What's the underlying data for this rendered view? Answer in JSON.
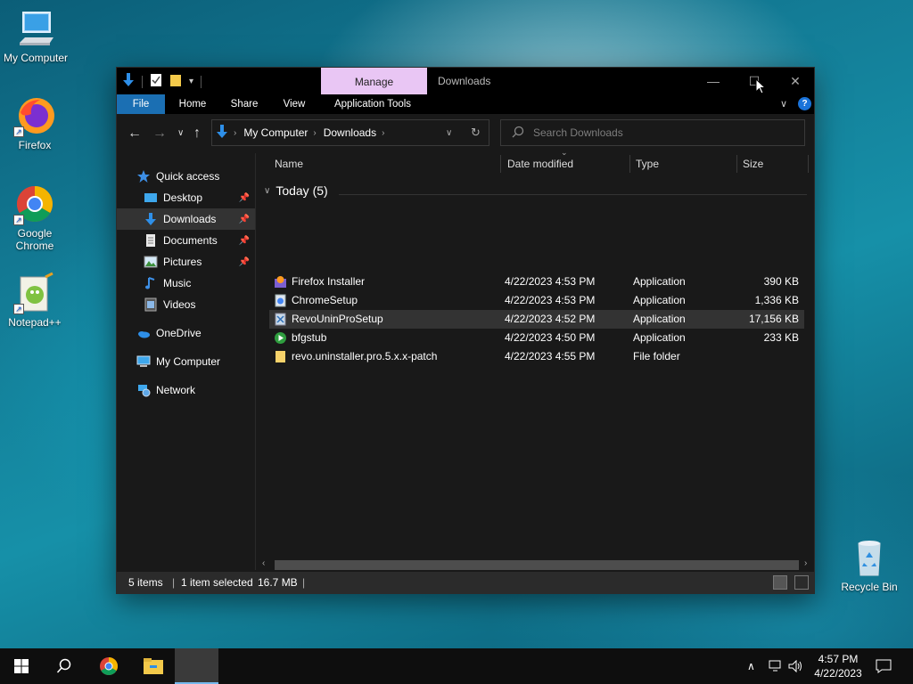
{
  "desktop": {
    "icons": [
      {
        "label": "My Computer"
      },
      {
        "label": "Firefox"
      },
      {
        "label": "Google Chrome"
      },
      {
        "label": "Notepad++"
      },
      {
        "label": "Recycle Bin"
      }
    ]
  },
  "window": {
    "contextual_tab": "Manage",
    "title": "Downloads",
    "ribbon_tabs": [
      "File",
      "Home",
      "Share",
      "View",
      "Application Tools"
    ],
    "address": {
      "crumbs": [
        "My Computer",
        "Downloads"
      ]
    },
    "search": {
      "placeholder": "Search Downloads"
    },
    "nav_pane": {
      "quick_access": "Quick access",
      "quick_items": [
        "Desktop",
        "Downloads",
        "Documents",
        "Pictures",
        "Music",
        "Videos"
      ],
      "onedrive": "OneDrive",
      "my_computer": "My Computer",
      "network": "Network"
    },
    "columns": {
      "name": "Name",
      "date": "Date modified",
      "type": "Type",
      "size": "Size"
    },
    "group": "Today (5)",
    "files": [
      {
        "name": "Firefox Installer",
        "date": "4/22/2023 4:53 PM",
        "type": "Application",
        "size": "390 KB"
      },
      {
        "name": "ChromeSetup",
        "date": "4/22/2023 4:53 PM",
        "type": "Application",
        "size": "1,336 KB"
      },
      {
        "name": "RevoUninProSetup",
        "date": "4/22/2023 4:52 PM",
        "type": "Application",
        "size": "17,156 KB"
      },
      {
        "name": "bfgstub",
        "date": "4/22/2023 4:50 PM",
        "type": "Application",
        "size": "233 KB"
      },
      {
        "name": "revo.uninstaller.pro.5.x.x-patch",
        "date": "4/22/2023 4:55 PM",
        "type": "File folder",
        "size": ""
      }
    ],
    "status": {
      "items": "5 items",
      "selected": "1 item selected",
      "size": "16.7 MB"
    }
  },
  "taskbar": {
    "time": "4:57 PM",
    "date": "4/22/2023"
  },
  "colors": {
    "manage_tab": "#e9c6f4",
    "file_tab": "#1b6fb3",
    "selection": "#333333"
  }
}
